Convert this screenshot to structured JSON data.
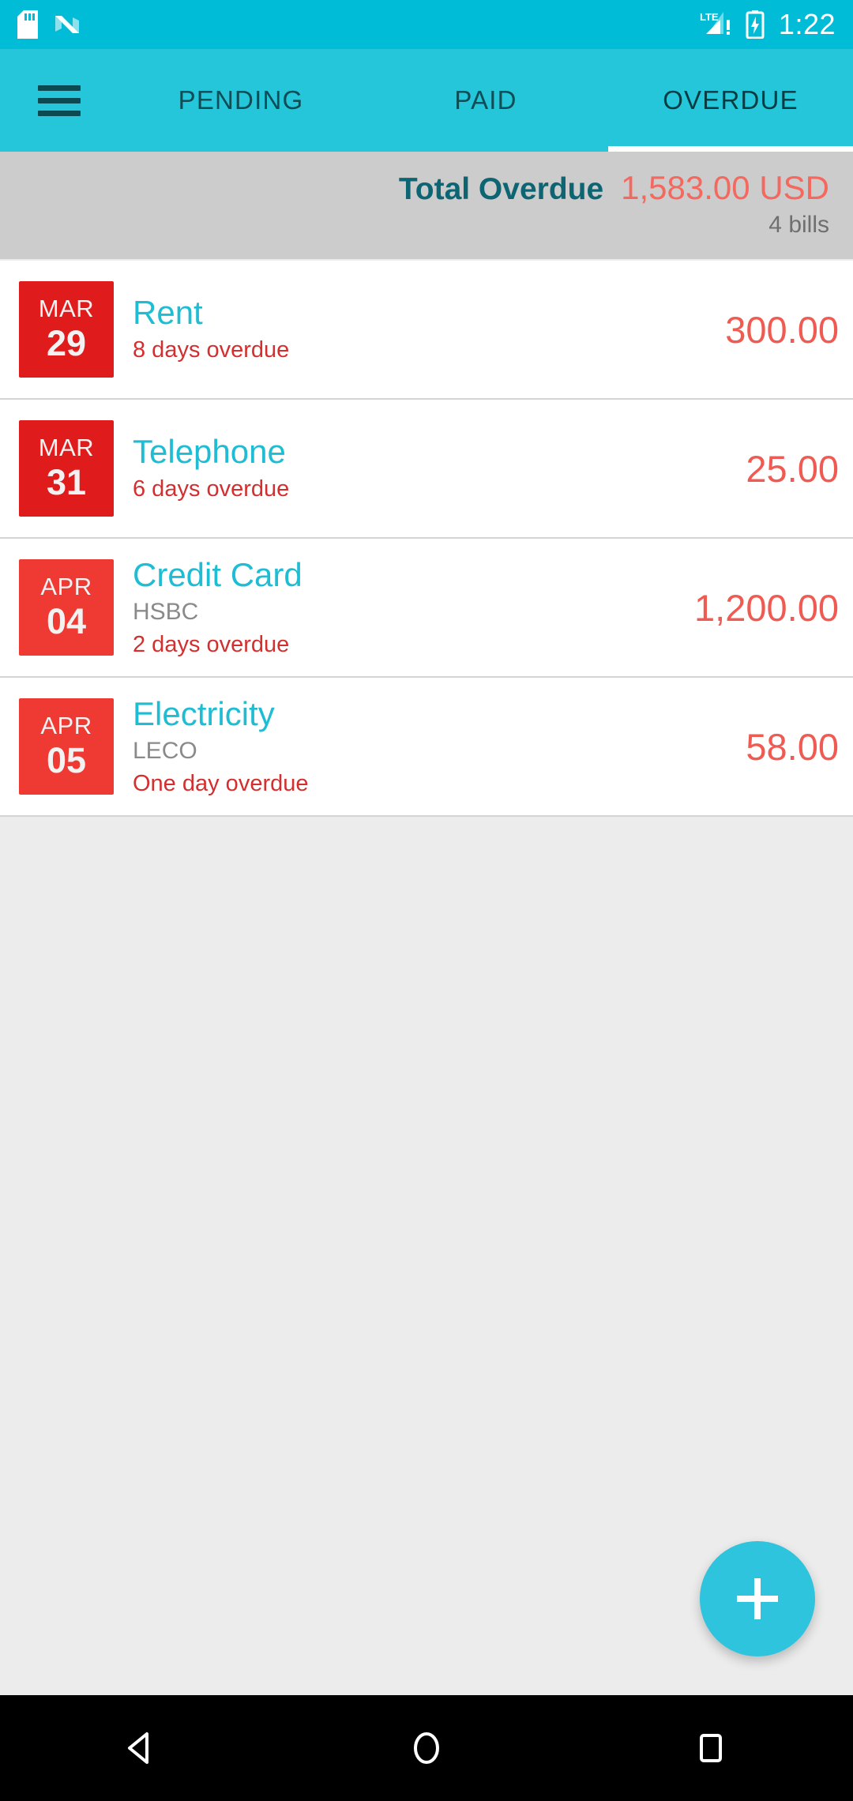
{
  "status_bar": {
    "icons_left": [
      "sd-card-icon",
      "android-nougat-icon"
    ],
    "network_label": "LTE",
    "icons_right": [
      "signal-icon",
      "battery-charging-icon"
    ],
    "time": "1:22",
    "background_color": "#00bcd6"
  },
  "app_bar": {
    "menu_icon": "hamburger-menu-icon",
    "background_color": "#26c6da",
    "tabs": [
      {
        "label": "PENDING",
        "active": false
      },
      {
        "label": "PAID",
        "active": false
      },
      {
        "label": "OVERDUE",
        "active": true
      }
    ]
  },
  "summary": {
    "label": "Total Overdue",
    "amount": "1,583.00 USD",
    "count": "4 bills",
    "label_color": "#0d6573",
    "amount_color": "#f4685e",
    "background_color": "#cccccc"
  },
  "bills": [
    {
      "month": "MAR",
      "day": "29",
      "badge_color": "#e01b1b",
      "title": "Rent",
      "subtitle": "",
      "status": "8 days overdue",
      "amount": "300.00"
    },
    {
      "month": "MAR",
      "day": "31",
      "badge_color": "#e01b1b",
      "title": "Telephone",
      "subtitle": "",
      "status": "6 days overdue",
      "amount": "25.00"
    },
    {
      "month": "APR",
      "day": "04",
      "badge_color": "#ee3a33",
      "title": "Credit Card",
      "subtitle": "HSBC",
      "status": "2 days overdue",
      "amount": "1,200.00"
    },
    {
      "month": "APR",
      "day": "05",
      "badge_color": "#ee3a33",
      "title": "Electricity",
      "subtitle": "LECO",
      "status": "One day overdue",
      "amount": "58.00"
    }
  ],
  "fab": {
    "icon": "plus-icon",
    "color": "#2ec4dd"
  },
  "nav_bar": {
    "buttons": [
      "back-icon",
      "home-icon",
      "recents-icon"
    ],
    "background_color": "#000000"
  }
}
